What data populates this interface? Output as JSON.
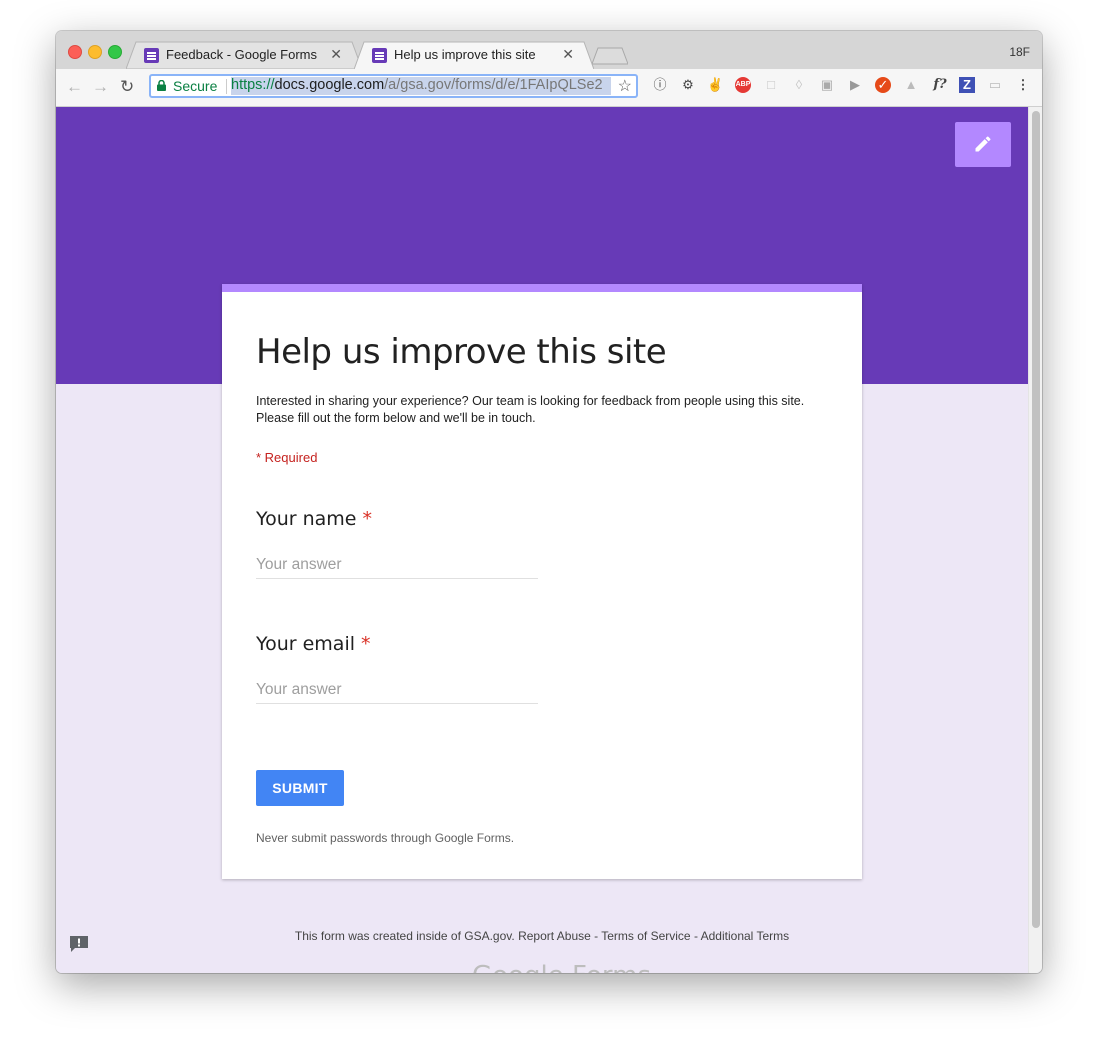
{
  "browser": {
    "tabs": [
      {
        "title": "Feedback - Google Forms",
        "close": "✕"
      },
      {
        "title": "Help us improve this site",
        "close": "✕"
      }
    ],
    "profile": "18F",
    "address": {
      "secure_label": "Secure",
      "url_scheme": "https://",
      "url_host": "docs.google.com",
      "url_path": "/a/gsa.gov/forms/d/e/1FAIpQLSe2"
    },
    "extensions": [
      "info-icon",
      "gear-icon",
      "peace-icon",
      "adblock-icon",
      "extension-icon",
      "extension-icon",
      "extension-icon",
      "play-icon",
      "extension-icon",
      "extension-icon",
      "font-icon",
      "zotero-icon",
      "cast-icon",
      "menu-icon"
    ],
    "ext_labels": {
      "font": "f?",
      "zotero": "Z",
      "abp": "ABP"
    }
  },
  "form": {
    "title": "Help us improve this site",
    "description": "Interested in sharing your experience? Our team is looking for feedback from people using this site. Please fill out the form below and we'll be in touch.",
    "required_note": "* Required",
    "questions": [
      {
        "label": "Your name",
        "required_mark": "*",
        "placeholder": "Your answer"
      },
      {
        "label": "Your email",
        "required_mark": "*",
        "placeholder": "Your answer"
      }
    ],
    "submit_label": "SUBMIT",
    "password_warning": "Never submit passwords through Google Forms."
  },
  "footer": {
    "created_text": "This form was created inside of GSA.gov.",
    "report_abuse": "Report Abuse",
    "sep1": " - ",
    "terms": "Terms of Service",
    "sep2": " - ",
    "additional": "Additional Terms",
    "logo": "Google Forms"
  },
  "colors": {
    "banner": "#673ab7",
    "accent": "#b388ff",
    "background": "#ede7f6",
    "submit": "#4285f4",
    "required": "#c5221f"
  }
}
